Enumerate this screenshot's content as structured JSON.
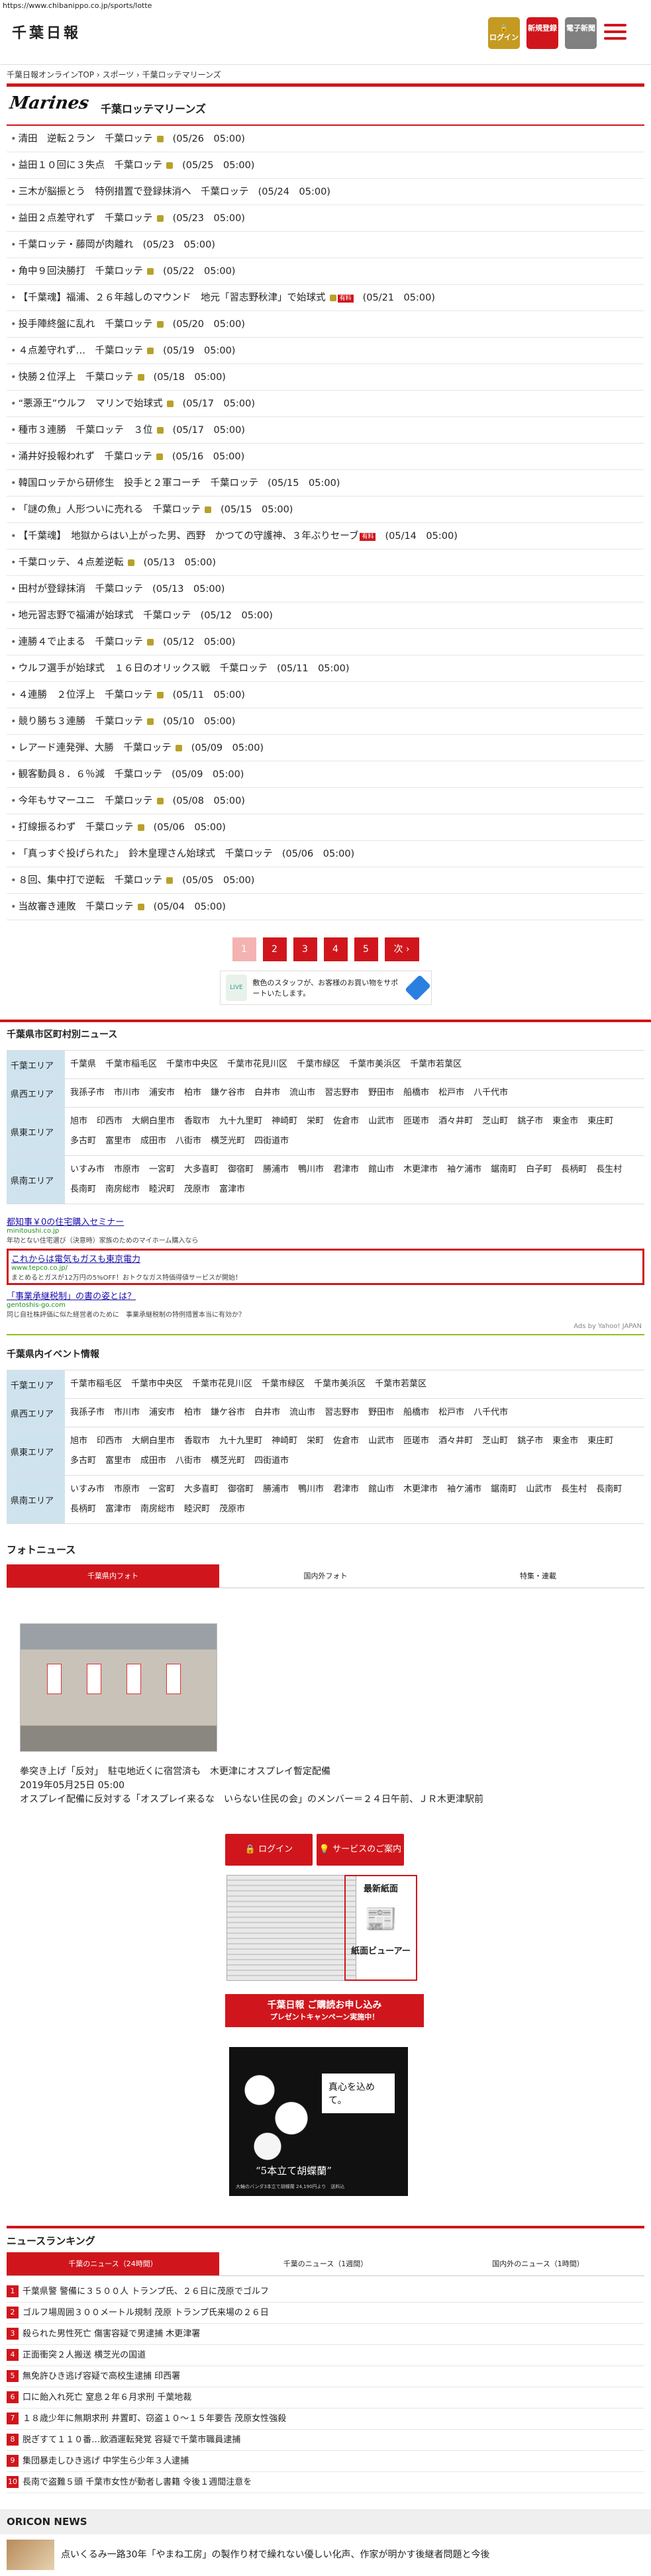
{
  "url": "https://www.chibanippo.co.jp/sports/lotte",
  "header": {
    "logo": "千葉日報",
    "login_label": "ログイン",
    "register_label": "新規登録",
    "paper_label": "電子新聞"
  },
  "breadcrumb": "千葉日報オンラインTOP › スポーツ › 千葉ロッテマリーンズ",
  "team": {
    "logo_text": "Marines",
    "title": "千葉ロッテマリーンズ"
  },
  "news": [
    {
      "title": "清田　逆転２ラン　千葉ロッテ",
      "date": "(05/26　05:00)",
      "photo": true
    },
    {
      "title": "益田１０回に３失点　千葉ロッテ",
      "date": "(05/25　05:00)",
      "photo": true
    },
    {
      "title": "三木が脳振とう　特例措置で登録抹消へ　千葉ロッテ",
      "date": "(05/24　05:00)",
      "photo": false
    },
    {
      "title": "益田２点差守れず　千葉ロッテ",
      "date": "(05/23　05:00)",
      "photo": true
    },
    {
      "title": "千葉ロッテ・藤岡が肉離れ",
      "date": "(05/23　05:00)",
      "photo": false
    },
    {
      "title": "角中９回決勝打　千葉ロッテ",
      "date": "(05/22　05:00)",
      "photo": true
    },
    {
      "title": "【千葉魂】福浦、２６年越しのマウンド　地元「習志野秋津」で始球式",
      "date": "(05/21　05:00)",
      "photo": true,
      "pay": true
    },
    {
      "title": "投手陣終盤に乱れ　千葉ロッテ",
      "date": "(05/20　05:00)",
      "photo": true
    },
    {
      "title": "４点差守れず…　千葉ロッテ",
      "date": "(05/19　05:00)",
      "photo": true
    },
    {
      "title": "快勝２位浮上　千葉ロッテ",
      "date": "(05/18　05:00)",
      "photo": true
    },
    {
      "title": "“悪源王”ウルフ　マリンで始球式",
      "date": "(05/17　05:00)",
      "photo": true
    },
    {
      "title": "種市３連勝　千葉ロッテ　３位",
      "date": "(05/17　05:00)",
      "photo": true
    },
    {
      "title": "涌井好投報われず　千葉ロッテ",
      "date": "(05/16　05:00)",
      "photo": true
    },
    {
      "title": "韓国ロッテから研修生　投手と２軍コーチ　千葉ロッテ",
      "date": "(05/15　05:00)",
      "photo": false
    },
    {
      "title": "「謎の魚」人形ついに売れる　千葉ロッテ",
      "date": "(05/15　05:00)",
      "photo": true
    },
    {
      "title": "【千葉魂】　地獄からはい上がった男、西野　かつての守護神、３年ぶりセーブ",
      "date": "(05/14　05:00)",
      "photo": false,
      "pay": true
    },
    {
      "title": "千葉ロッテ、４点差逆転",
      "date": "(05/13　05:00)",
      "photo": true
    },
    {
      "title": "田村が登録抹消　千葉ロッテ",
      "date": "(05/13　05:00)",
      "photo": false
    },
    {
      "title": "地元習志野で福浦が始球式　千葉ロッテ",
      "date": "(05/12　05:00)",
      "photo": false
    },
    {
      "title": "連勝４で止まる　千葉ロッテ",
      "date": "(05/12　05:00)",
      "photo": true
    },
    {
      "title": "ウルフ選手が始球式　１６日のオリックス戦　千葉ロッテ",
      "date": "(05/11　05:00)",
      "photo": false
    },
    {
      "title": "４連勝　２位浮上　千葉ロッテ",
      "date": "(05/11　05:00)",
      "photo": true
    },
    {
      "title": "競り勝ち３連勝　千葉ロッテ",
      "date": "(05/10　05:00)",
      "photo": true
    },
    {
      "title": "レアード連発弾、大勝　千葉ロッテ",
      "date": "(05/09　05:00)",
      "photo": true
    },
    {
      "title": "観客動員８．６％減　千葉ロッテ",
      "date": "(05/09　05:00)",
      "photo": false
    },
    {
      "title": "今年もサマーユニ　千葉ロッテ",
      "date": "(05/08　05:00)",
      "photo": true
    },
    {
      "title": "打線振るわず　千葉ロッテ",
      "date": "(05/06　05:00)",
      "photo": true
    },
    {
      "title": "「真っすぐ投げられた」　鈴木皇理さん始球式　千葉ロッテ",
      "date": "(05/06　05:00)",
      "photo": false
    },
    {
      "title": "８回、集中打で逆転　千葉ロッテ",
      "date": "(05/05　05:00)",
      "photo": true
    },
    {
      "title": "当故審き連敗　千葉ロッテ",
      "date": "(05/04　05:00)",
      "photo": true
    }
  ],
  "pager": [
    "1",
    "2",
    "3",
    "4",
    "5",
    "次 ›"
  ],
  "ad_banner": "敷色のスタッフが、お客様のお買い物をサポートいたします。",
  "municipal_news": {
    "heading": "千葉県市区町村別ニュース",
    "rows": [
      {
        "label": "千葉エリア",
        "items": [
          "千葉県",
          "千葉市稲毛区",
          "千葉市中央区",
          "千葉市花見川区",
          "千葉市緑区",
          "千葉市美浜区",
          "千葉市若葉区"
        ]
      },
      {
        "label": "県西エリア",
        "items": [
          "我孫子市",
          "市川市",
          "浦安市",
          "柏市",
          "鎌ケ谷市",
          "白井市",
          "流山市",
          "習志野市",
          "野田市",
          "船橋市",
          "松戸市",
          "八千代市"
        ]
      },
      {
        "label": "県東エリア",
        "items": [
          "旭市",
          "印西市",
          "大網白里市",
          "香取市",
          "九十九里町",
          "神崎町",
          "栄町",
          "佐倉市",
          "山武市",
          "匝瑳市",
          "酒々井町",
          "芝山町",
          "銚子市",
          "東金市",
          "東庄町",
          "多古町",
          "富里市",
          "成田市",
          "八街市",
          "横芝光町",
          "四街道市"
        ]
      },
      {
        "label": "県南エリア",
        "items": [
          "いすみ市",
          "市原市",
          "一宮町",
          "大多喜町",
          "御宿町",
          "勝浦市",
          "鴨川市",
          "君津市",
          "館山市",
          "木更津市",
          "袖ケ浦市",
          "鋸南町",
          "白子町",
          "長柄町",
          "長生村",
          "長南町",
          "南房総市",
          "睦沢町",
          "茂原市",
          "富津市"
        ]
      }
    ]
  },
  "text_ads": [
    {
      "title": "都知事￥0の住宅購入セミナー",
      "url": "minitoushi.co.jp",
      "desc": "年功とない住宅選び（決意時）家族のためのマイホーム購入なら"
    },
    {
      "title": "これからは電気もガスも東京電力",
      "url": "www.tepco.co.jp/",
      "desc": "まとめるとガスが12万円の5%OFF！おトクなガス特価得値サービスが開始！"
    },
    {
      "title": "「事業承継税制」の書の姿とは？",
      "url": "gentoshis-go.com",
      "desc": "同じ自社株評価に似た経営者のために　事業承継税制の特例措置本当に有効か？"
    }
  ],
  "ads_footer": "Ads by Yahoo! JAPAN",
  "events": {
    "heading": "千葉県内イベント情報",
    "rows": [
      {
        "label": "千葉エリア",
        "items": [
          "千葉市稲毛区",
          "千葉市中央区",
          "千葉市花見川区",
          "千葉市緑区",
          "千葉市美浜区",
          "千葉市若葉区"
        ]
      },
      {
        "label": "県西エリア",
        "items": [
          "我孫子市",
          "市川市",
          "浦安市",
          "柏市",
          "鎌ケ谷市",
          "白井市",
          "流山市",
          "習志野市",
          "野田市",
          "船橋市",
          "松戸市",
          "八千代市"
        ]
      },
      {
        "label": "県東エリア",
        "items": [
          "旭市",
          "印西市",
          "大網白里市",
          "香取市",
          "九十九里町",
          "神崎町",
          "栄町",
          "佐倉市",
          "山武市",
          "匝瑳市",
          "酒々井町",
          "芝山町",
          "銚子市",
          "東金市",
          "東庄町",
          "多古町",
          "富里市",
          "成田市",
          "八街市",
          "横芝光町",
          "四街道市"
        ]
      },
      {
        "label": "県南エリア",
        "items": [
          "いすみ市",
          "市原市",
          "一宮町",
          "大多喜町",
          "御宿町",
          "勝浦市",
          "鴨川市",
          "君津市",
          "館山市",
          "木更津市",
          "袖ケ浦市",
          "鋸南町",
          "山武市",
          "長生村",
          "長南町",
          "長柄町",
          "富津市",
          "南房総市",
          "睦沢町",
          "茂原市"
        ]
      }
    ]
  },
  "photo_news": {
    "heading": "フォトニュース",
    "tabs": [
      "千葉県内フォト",
      "国内外フォト",
      "特集・連載"
    ],
    "headline": "拳突き上げ「反対」　駐屯地近くに宿営済も　木更津にオスプレイ暫定配備",
    "date": "2019年05月25日 05:00",
    "summary": "オスプレイ配備に反対する「オスプレイ来るな　いらない住民の会」のメンバー＝２４日午前、ＪＲ木更津駅前"
  },
  "promo": {
    "login_label": "ログイン",
    "service_label": "サービスのご案内",
    "latest_paper_label": "最新紙面",
    "viewer_label": "紙面ビューアー",
    "campaign_label": "千葉日報 ご購読お申し込み",
    "campaign_sub": "プレゼントキャンペーン実施中！",
    "orchid_note": "真心を込めて。",
    "orchid_caption": "“5本立て胡蝶蘭”",
    "orchid_fine": "大輪のバンダ3本立て胡蝶蘭 24,190円より　送料込"
  },
  "ranking": {
    "heading": "ニュースランキング",
    "tabs": [
      "千葉のニュース（24時間）",
      "千葉のニュース（1週間）",
      "国内外のニュース（1時間）"
    ],
    "items": [
      "千葉県警 警備に３５００人 トランプ氏、２６日に茂原でゴルフ",
      "ゴルフ場周囲３００メートル規制 茂原 トランプ氏来場の２６日",
      "殺られた男性死亡 傷害容疑で男逮捕 木更津署",
      "正面衝突２人搬送 横芝光の国道",
      "無免許ひき逃げ容疑で高校生逮捕 印西署",
      "口に飴入れ死亡 窒息２年６月求刑 千葉地裁",
      "１８歳少年に無期求刑 井置町、窃盗１０〜１５年要告 茂原女性強殺",
      "脱ぎすて１１０番…飲酒運転発覚 容疑で千葉市職員逮捕",
      "集団暴走しひき逃げ 中学生ら少年３人逮捕",
      "長南で盗難５頭 千葉市女性が動者し書籍 令後１週間注意を"
    ]
  },
  "oricon": {
    "heading": "ORICON NEWS",
    "item": "点いくるみ一路30年「やまね工房」の製作り材で繰れない優しい化声、作家が明かす後継者問題と今後"
  }
}
